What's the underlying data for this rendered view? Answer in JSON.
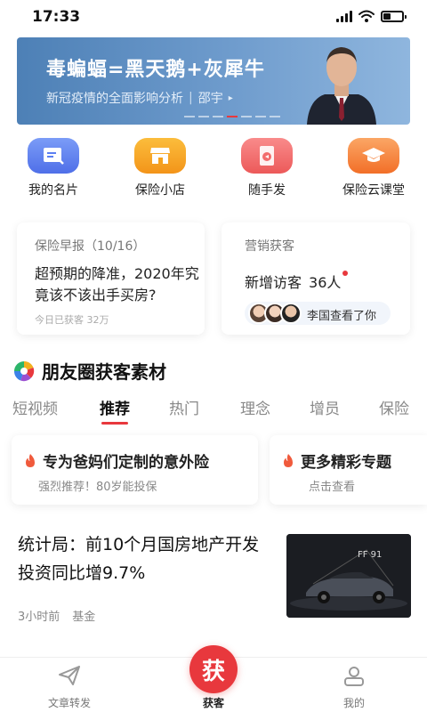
{
  "status_bar": {
    "time": "17:33"
  },
  "banner": {
    "title": "毒蝙蝠=黑天鹅+灰犀牛",
    "subtitle": "新冠疫情的全面影响分析",
    "author": "邵宇",
    "arrow": "▸"
  },
  "quick_actions": [
    {
      "label": "我的名片",
      "icon": "card-icon",
      "color": "#5b7ff2"
    },
    {
      "label": "保险小店",
      "icon": "shop-icon",
      "color": "#f5a21e"
    },
    {
      "label": "随手发",
      "icon": "share-icon",
      "color": "#f26b6b"
    },
    {
      "label": "保险云课堂",
      "icon": "graduation-cap-icon",
      "color": "#f58a3d"
    }
  ],
  "cards": {
    "news": {
      "title": "保险早报（10/16）",
      "body": "超预期的降准，2020年究竟该不该出手买房?",
      "footer": "今日已获客 32万"
    },
    "marketing": {
      "title": "营销获客",
      "visitor_label": "新增访客",
      "visitor_count": "36人",
      "viewer_text": "李国查看了你"
    }
  },
  "section": {
    "title": "朋友圈获客素材"
  },
  "tabs": [
    {
      "label": "短视频"
    },
    {
      "label": "推荐",
      "active": true
    },
    {
      "label": "热门"
    },
    {
      "label": "理念"
    },
    {
      "label": "增员"
    },
    {
      "label": "保险"
    }
  ],
  "topics": [
    {
      "title": "专为爸妈们定制的意外险",
      "subtitle": "强烈推荐！80岁能投保"
    },
    {
      "title": "更多精彩专题",
      "subtitle": "点击查看"
    }
  ],
  "article": {
    "title": "统计局：前10个月国房地产开发投资同比增9.7%",
    "time": "3小时前",
    "tag": "基金",
    "thumb_text": "FF 91"
  },
  "bottom_nav": {
    "left": "文章转发",
    "center_icon_text": "获",
    "center": "获客",
    "right": "我的"
  },
  "colors": {
    "accent": "#e8383d",
    "banner": "#5a8cc4"
  }
}
